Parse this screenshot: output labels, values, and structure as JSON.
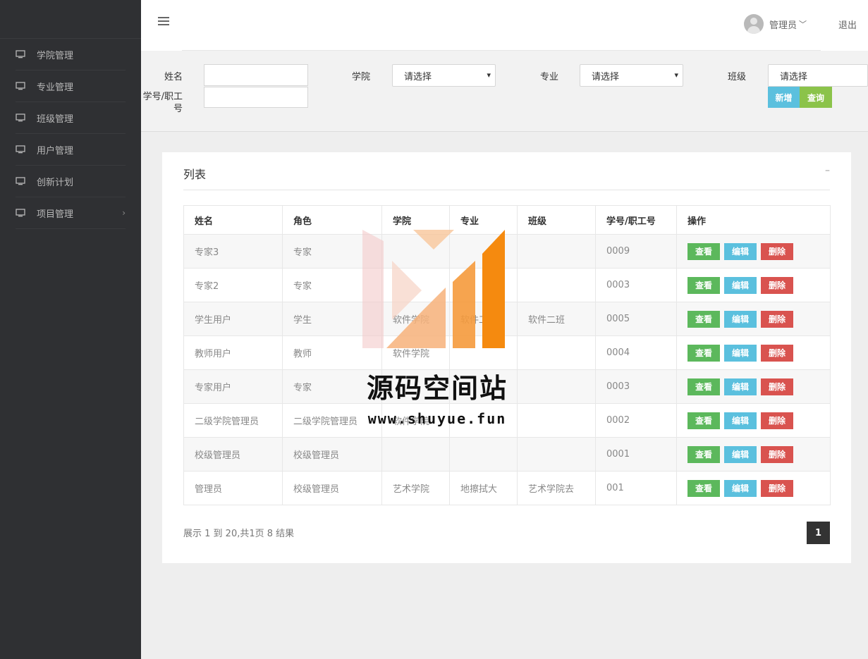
{
  "sidebar": {
    "items": [
      {
        "label": "学院管理",
        "icon": "monitor-icon"
      },
      {
        "label": "专业管理",
        "icon": "monitor-icon"
      },
      {
        "label": "班级管理",
        "icon": "monitor-icon"
      },
      {
        "label": "用户管理",
        "icon": "monitor-icon"
      },
      {
        "label": "创新计划",
        "icon": "monitor-icon"
      },
      {
        "label": "项目管理",
        "icon": "monitor-icon",
        "arrow": "›"
      }
    ]
  },
  "header": {
    "user_name": "管理员",
    "user_chevron": "﹀",
    "logout": "退出"
  },
  "filter": {
    "name_label": "姓名",
    "college_label": "学院",
    "major_label": "专业",
    "class_label": "班级",
    "id_label_line1": "学号/职工",
    "id_label_line2": "号",
    "college_value": "请选择",
    "major_value": "请选择",
    "class_value": "请选择",
    "add_button": "新增",
    "query_button": "查询"
  },
  "panel": {
    "title": "列表",
    "collapse": "–",
    "columns": [
      "姓名",
      "角色",
      "学院",
      "专业",
      "班级",
      "学号/职工号",
      "操作"
    ],
    "rows": [
      {
        "name": "专家3",
        "role": "专家",
        "college": "",
        "major": "",
        "class": "",
        "id": "0009"
      },
      {
        "name": "专家2",
        "role": "专家",
        "college": "",
        "major": "",
        "class": "",
        "id": "0003"
      },
      {
        "name": "学生用户",
        "role": "学生",
        "college": "软件学院",
        "major": "软件工",
        "class": "软件二班",
        "id": "0005"
      },
      {
        "name": "教师用户",
        "role": "教师",
        "college": "软件学院",
        "major": "",
        "class": "",
        "id": "0004"
      },
      {
        "name": "专家用户",
        "role": "专家",
        "college": "",
        "major": "",
        "class": "",
        "id": "0003"
      },
      {
        "name": "二级学院管理员",
        "role": "二级学院管理员",
        "college": "软件学院",
        "major": "",
        "class": "",
        "id": "0002"
      },
      {
        "name": "校级管理员",
        "role": "校级管理员",
        "college": "",
        "major": "",
        "class": "",
        "id": "0001"
      },
      {
        "name": "管理员",
        "role": "校级管理员",
        "college": "艺术学院",
        "major": "地擦拭大",
        "class": "艺术学院去",
        "id": "001"
      }
    ],
    "actions": {
      "view": "查看",
      "edit": "编辑",
      "delete": "删除"
    },
    "summary": "展示 1 到 20,共1页 8 结果",
    "page": "1"
  },
  "watermark": {
    "text": "源码空间站",
    "url": "www.shuyue.fun"
  }
}
